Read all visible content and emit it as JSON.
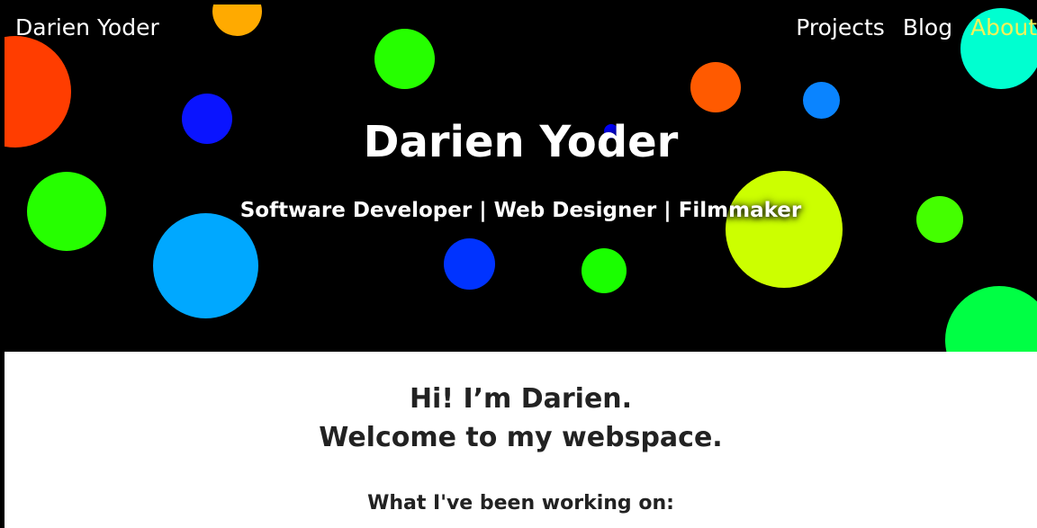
{
  "nav": {
    "brand": "Darien Yoder",
    "links": [
      {
        "label": "Projects"
      },
      {
        "label": "Blog"
      },
      {
        "label": "About"
      }
    ],
    "active_color": "#f2f25a"
  },
  "hero": {
    "title": "Darien Yoder",
    "subtitle": "Software Developer | Web Designer | Filmmaker",
    "background_color": "#000000",
    "dot_colors": [
      "#ff3d00",
      "#ffaa00",
      "#26ff00",
      "#0000ff",
      "#ff5a00",
      "#0a84ff",
      "#00ffd0",
      "#00a8ff",
      "#0033ff",
      "#ccff00",
      "#00ff66"
    ]
  },
  "intro": {
    "line1": "Hi! I’m Darien.",
    "line2": "Welcome to my webspace.",
    "working_heading": "What I've been working on:"
  }
}
